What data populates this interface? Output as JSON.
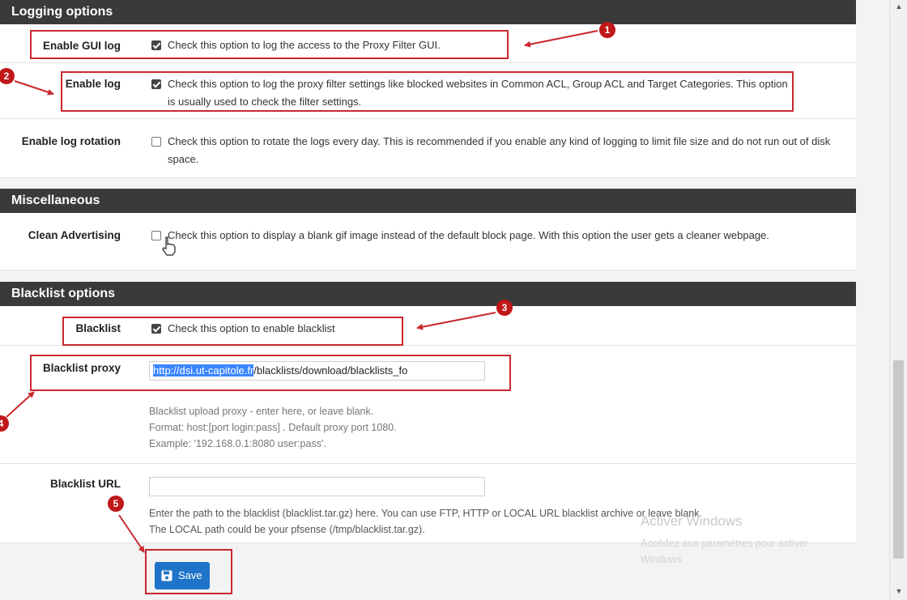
{
  "sections": {
    "logging": "Logging options",
    "misc": "Miscellaneous",
    "blacklist": "Blacklist options"
  },
  "logging": {
    "gui_log": {
      "label": "Enable GUI log",
      "desc": "Check this option to log the access to the Proxy Filter GUI.",
      "checked": true
    },
    "log": {
      "label": "Enable log",
      "desc": "Check this option to log the proxy filter settings like blocked websites in Common ACL, Group ACL and Target Categories. This option is usually used to check the filter settings.",
      "checked": true
    },
    "rotation": {
      "label": "Enable log rotation",
      "desc": "Check this option to rotate the logs every day. This is recommended if you enable any kind of logging to limit file size and do not run out of disk space.",
      "checked": false
    }
  },
  "misc": {
    "clean_ads": {
      "label": "Clean Advertising",
      "desc": "Check this option to display a blank gif image instead of the default block page. With this option the user gets a cleaner webpage.",
      "checked": false
    }
  },
  "blacklist": {
    "enable": {
      "label": "Blacklist",
      "desc": "Check this option to enable blacklist",
      "checked": true
    },
    "proxy": {
      "label": "Blacklist proxy",
      "value_selected": "http://dsi.ut-capitole.fr",
      "value_rest": "/blacklists/download/blacklists_fo",
      "help": [
        "Blacklist upload proxy - enter here, or leave blank.",
        "Format: host:[port login:pass] . Default proxy port 1080.",
        "Example: '192.168.0.1:8080 user:pass'."
      ]
    },
    "url": {
      "label": "Blacklist URL",
      "value": "",
      "help": [
        "Enter the path to the blacklist (blacklist.tar.gz) here. You can use FTP, HTTP or LOCAL URL blacklist archive or leave blank.",
        "The LOCAL path could be your pfsense (/tmp/blacklist.tar.gz)."
      ]
    }
  },
  "save_label": "Save",
  "markers": [
    "1",
    "2",
    "3",
    "4",
    "5"
  ],
  "watermark": {
    "line1": "Activer Windows",
    "line2": "Accédez aux paramètres pour activer",
    "line3": "Windows."
  },
  "colors": {
    "annotation_red": "#c9282d",
    "save_blue": "#1f74c9",
    "header_dark": "#3a3a3a"
  }
}
